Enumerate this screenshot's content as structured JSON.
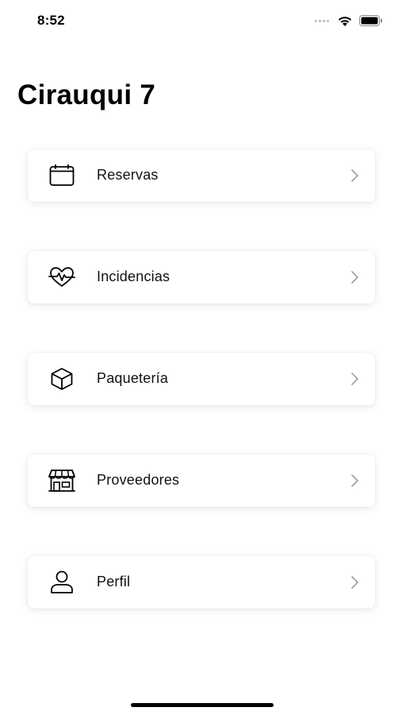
{
  "status_bar": {
    "time": "8:52"
  },
  "header": {
    "title": "Cirauqui 7"
  },
  "menu": {
    "items": [
      {
        "label": "Reservas",
        "icon": "calendar-icon"
      },
      {
        "label": "Incidencias",
        "icon": "heart-pulse-icon"
      },
      {
        "label": "Paquetería",
        "icon": "package-icon"
      },
      {
        "label": "Proveedores",
        "icon": "store-icon"
      },
      {
        "label": "Perfil",
        "icon": "user-icon"
      }
    ]
  },
  "colors": {
    "background": "#ffffff",
    "card": "#ffffff",
    "text": "#111111",
    "chevron": "#9e9e9e"
  }
}
